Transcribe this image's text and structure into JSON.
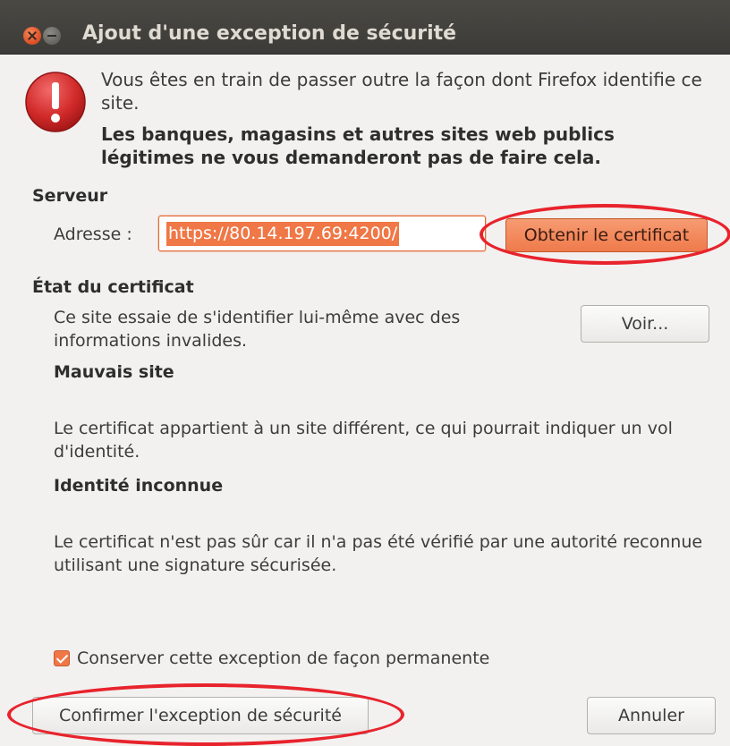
{
  "window": {
    "title": "Ajout d'une exception de sécurité",
    "icons": {
      "close": "close-icon",
      "minimize": "minimize-icon",
      "warning": "warning-icon"
    }
  },
  "intro": {
    "line1": "Vous êtes en train de passer outre la façon dont Firefox identifie ce site.",
    "line2": "Les banques, magasins et autres sites web publics légitimes ne vous demanderont pas de faire cela."
  },
  "server": {
    "heading": "Serveur",
    "address_label": "Adresse :",
    "address_value": "https://80.14.197.69:4200/",
    "get_cert_button": "Obtenir le certificat"
  },
  "cert": {
    "heading": "État du certificat",
    "status_text": "Ce site essaie de s'identifier lui-même avec des informations invalides.",
    "view_button": "Voir...",
    "bad_site_heading": "Mauvais site",
    "bad_site_text": "Le certificat appartient à un site différent, ce qui pourrait indiquer un vol d'identité.",
    "unknown_heading": "Identité inconnue",
    "unknown_text": "Le certificat n'est pas sûr car il n'a pas été vérifié par une autorité reconnue utilisant une signature sécurisée."
  },
  "permanent": {
    "label": "Conserver cette exception de façon permanente",
    "checked": true
  },
  "footer": {
    "confirm_button": "Confirmer l'exception de sécurité",
    "cancel_button": "Annuler"
  },
  "colors": {
    "accent": "#f07746",
    "annotation_ring": "#e8232c",
    "titlebar": "#3c3b37",
    "warning_red": "#d22a2a"
  }
}
